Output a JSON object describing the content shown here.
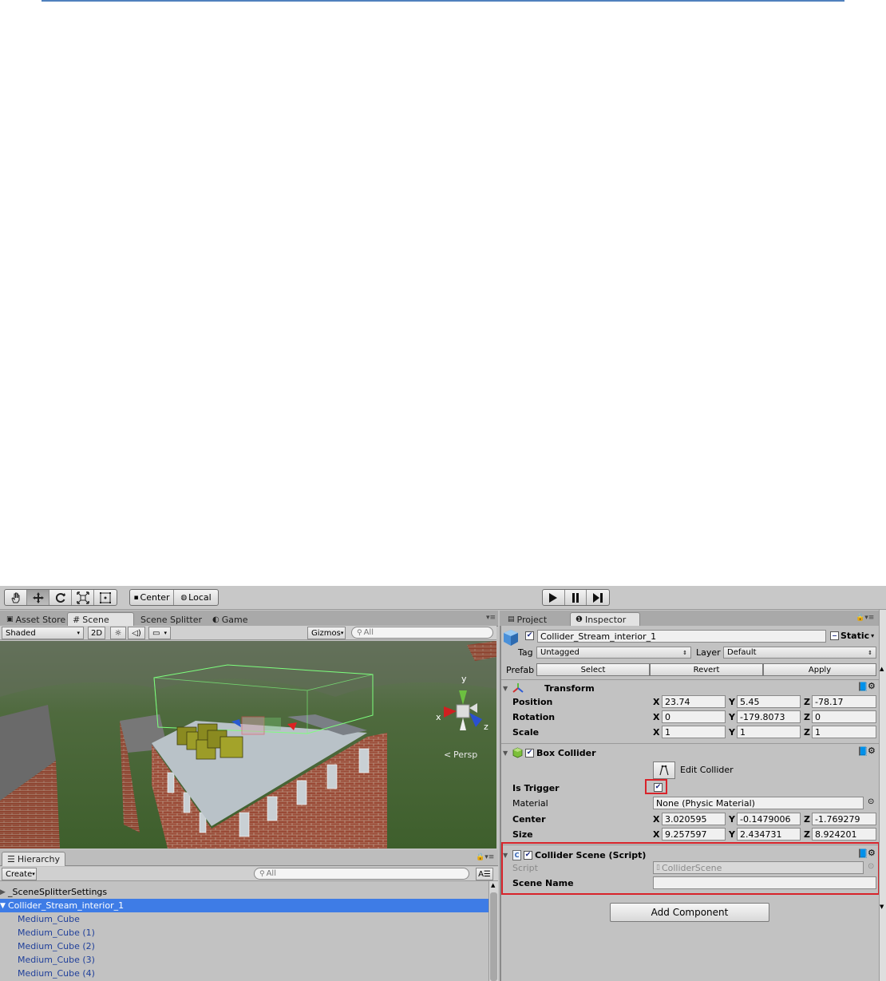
{
  "toolbar": {
    "pivot_center": "Center",
    "pivot_local": "Local"
  },
  "scene_tabs": [
    {
      "label": "Asset Store"
    },
    {
      "label": "Scene"
    },
    {
      "label": "Scene Splitter"
    },
    {
      "label": "Game"
    }
  ],
  "scene_bar": {
    "draw_mode": "Shaded",
    "toggle_2d": "2D",
    "gizmos": "Gizmos",
    "search_placeholder": "All",
    "persp_label": "Persp",
    "axis_x": "x",
    "axis_y": "y",
    "axis_z": "z"
  },
  "hierarchy": {
    "tab": "Hierarchy",
    "create": "Create",
    "search_placeholder": "All",
    "items": [
      {
        "label": "_SceneSplitterSettings"
      },
      {
        "label": "Collider_Stream_interior_1"
      },
      {
        "label": "Medium_Cube"
      },
      {
        "label": "Medium_Cube (1)"
      },
      {
        "label": "Medium_Cube (2)"
      },
      {
        "label": "Medium_Cube (3)"
      },
      {
        "label": "Medium_Cube (4)"
      }
    ]
  },
  "inspector": {
    "tabs": [
      {
        "label": "Project"
      },
      {
        "label": "Inspector"
      }
    ],
    "object_name": "Collider_Stream_interior_1",
    "static_label": "Static",
    "tag_label": "Tag",
    "tag_value": "Untagged",
    "layer_label": "Layer",
    "layer_value": "Default",
    "prefab_label": "Prefab",
    "prefab_select": "Select",
    "prefab_revert": "Revert",
    "prefab_apply": "Apply",
    "transform": {
      "title": "Transform",
      "position": {
        "label": "Position",
        "x": "23.74",
        "y": "5.45",
        "z": "-78.17"
      },
      "rotation": {
        "label": "Rotation",
        "x": "0",
        "y": "-179.8073",
        "z": "0"
      },
      "scale": {
        "label": "Scale",
        "x": "1",
        "y": "1",
        "z": "1"
      }
    },
    "box_collider": {
      "title": "Box Collider",
      "edit_collider": "Edit Collider",
      "is_trigger": "Is Trigger",
      "material_label": "Material",
      "material_value": "None (Physic Material)",
      "center": {
        "label": "Center",
        "x": "3.020595",
        "y": "-0.1479006",
        "z": "-1.769279"
      },
      "size": {
        "label": "Size",
        "x": "9.257597",
        "y": "2.434731",
        "z": "8.924201"
      }
    },
    "script_component": {
      "title": "Collider Scene (Script)",
      "script_label": "Script",
      "script_value": "ColliderScene",
      "scene_name_label": "Scene Name",
      "scene_name_value": ""
    },
    "add_component": "Add Component"
  },
  "axis_letters": {
    "x": "X",
    "y": "Y",
    "z": "Z"
  },
  "colors": {
    "highlight_red": "#d8232a",
    "selection_blue": "#3e7ce6",
    "child_text": "#1f3f9a"
  }
}
